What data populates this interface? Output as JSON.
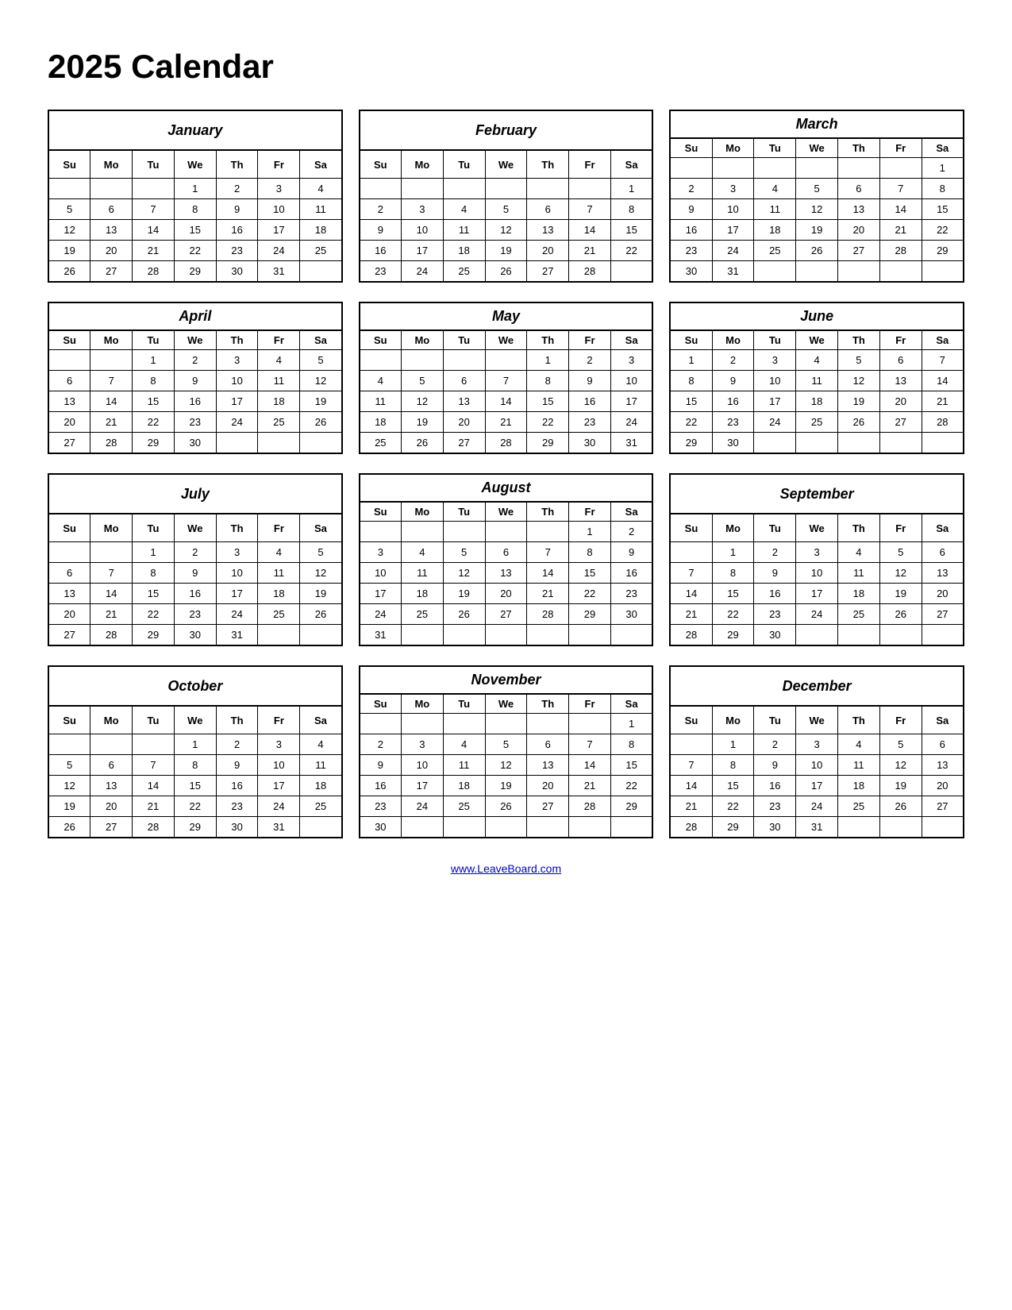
{
  "title": "2025 Calendar",
  "footer_link": "www.LeaveBoard.com",
  "months": [
    {
      "name": "January",
      "days_header": [
        "Su",
        "Mo",
        "Tu",
        "We",
        "Th",
        "Fr",
        "Sa"
      ],
      "weeks": [
        [
          "",
          "",
          "",
          "1",
          "2",
          "3",
          "4"
        ],
        [
          "5",
          "6",
          "7",
          "8",
          "9",
          "10",
          "11"
        ],
        [
          "12",
          "13",
          "14",
          "15",
          "16",
          "17",
          "18"
        ],
        [
          "19",
          "20",
          "21",
          "22",
          "23",
          "24",
          "25"
        ],
        [
          "26",
          "27",
          "28",
          "29",
          "30",
          "31",
          ""
        ]
      ]
    },
    {
      "name": "February",
      "days_header": [
        "Su",
        "Mo",
        "Tu",
        "We",
        "Th",
        "Fr",
        "Sa"
      ],
      "weeks": [
        [
          "",
          "",
          "",
          "",
          "",
          "",
          "1"
        ],
        [
          "2",
          "3",
          "4",
          "5",
          "6",
          "7",
          "8"
        ],
        [
          "9",
          "10",
          "11",
          "12",
          "13",
          "14",
          "15"
        ],
        [
          "16",
          "17",
          "18",
          "19",
          "20",
          "21",
          "22"
        ],
        [
          "23",
          "24",
          "25",
          "26",
          "27",
          "28",
          ""
        ]
      ]
    },
    {
      "name": "March",
      "days_header": [
        "Su",
        "Mo",
        "Tu",
        "We",
        "Th",
        "Fr",
        "Sa"
      ],
      "weeks": [
        [
          "",
          "",
          "",
          "",
          "",
          "",
          "1"
        ],
        [
          "2",
          "3",
          "4",
          "5",
          "6",
          "7",
          "8"
        ],
        [
          "9",
          "10",
          "11",
          "12",
          "13",
          "14",
          "15"
        ],
        [
          "16",
          "17",
          "18",
          "19",
          "20",
          "21",
          "22"
        ],
        [
          "23",
          "24",
          "25",
          "26",
          "27",
          "28",
          "29"
        ],
        [
          "30",
          "31",
          "",
          "",
          "",
          "",
          ""
        ]
      ]
    },
    {
      "name": "April",
      "days_header": [
        "Su",
        "Mo",
        "Tu",
        "We",
        "Th",
        "Fr",
        "Sa"
      ],
      "weeks": [
        [
          "",
          "",
          "1",
          "2",
          "3",
          "4",
          "5"
        ],
        [
          "6",
          "7",
          "8",
          "9",
          "10",
          "11",
          "12"
        ],
        [
          "13",
          "14",
          "15",
          "16",
          "17",
          "18",
          "19"
        ],
        [
          "20",
          "21",
          "22",
          "23",
          "24",
          "25",
          "26"
        ],
        [
          "27",
          "28",
          "29",
          "30",
          "",
          "",
          ""
        ]
      ]
    },
    {
      "name": "May",
      "days_header": [
        "Su",
        "Mo",
        "Tu",
        "We",
        "Th",
        "Fr",
        "Sa"
      ],
      "weeks": [
        [
          "",
          "",
          "",
          "",
          "1",
          "2",
          "3"
        ],
        [
          "4",
          "5",
          "6",
          "7",
          "8",
          "9",
          "10"
        ],
        [
          "11",
          "12",
          "13",
          "14",
          "15",
          "16",
          "17"
        ],
        [
          "18",
          "19",
          "20",
          "21",
          "22",
          "23",
          "24"
        ],
        [
          "25",
          "26",
          "27",
          "28",
          "29",
          "30",
          "31"
        ]
      ]
    },
    {
      "name": "June",
      "days_header": [
        "Su",
        "Mo",
        "Tu",
        "We",
        "Th",
        "Fr",
        "Sa"
      ],
      "weeks": [
        [
          "1",
          "2",
          "3",
          "4",
          "5",
          "6",
          "7"
        ],
        [
          "8",
          "9",
          "10",
          "11",
          "12",
          "13",
          "14"
        ],
        [
          "15",
          "16",
          "17",
          "18",
          "19",
          "20",
          "21"
        ],
        [
          "22",
          "23",
          "24",
          "25",
          "26",
          "27",
          "28"
        ],
        [
          "29",
          "30",
          "",
          "",
          "",
          "",
          ""
        ]
      ]
    },
    {
      "name": "July",
      "days_header": [
        "Su",
        "Mo",
        "Tu",
        "We",
        "Th",
        "Fr",
        "Sa"
      ],
      "weeks": [
        [
          "",
          "",
          "1",
          "2",
          "3",
          "4",
          "5"
        ],
        [
          "6",
          "7",
          "8",
          "9",
          "10",
          "11",
          "12"
        ],
        [
          "13",
          "14",
          "15",
          "16",
          "17",
          "18",
          "19"
        ],
        [
          "20",
          "21",
          "22",
          "23",
          "24",
          "25",
          "26"
        ],
        [
          "27",
          "28",
          "29",
          "30",
          "31",
          "",
          ""
        ]
      ]
    },
    {
      "name": "August",
      "days_header": [
        "Su",
        "Mo",
        "Tu",
        "We",
        "Th",
        "Fr",
        "Sa"
      ],
      "weeks": [
        [
          "",
          "",
          "",
          "",
          "",
          "1",
          "2"
        ],
        [
          "3",
          "4",
          "5",
          "6",
          "7",
          "8",
          "9"
        ],
        [
          "10",
          "11",
          "12",
          "13",
          "14",
          "15",
          "16"
        ],
        [
          "17",
          "18",
          "19",
          "20",
          "21",
          "22",
          "23"
        ],
        [
          "24",
          "25",
          "26",
          "27",
          "28",
          "29",
          "30"
        ],
        [
          "31",
          "",
          "",
          "",
          "",
          "",
          ""
        ]
      ]
    },
    {
      "name": "September",
      "days_header": [
        "Su",
        "Mo",
        "Tu",
        "We",
        "Th",
        "Fr",
        "Sa"
      ],
      "weeks": [
        [
          "",
          "1",
          "2",
          "3",
          "4",
          "5",
          "6"
        ],
        [
          "7",
          "8",
          "9",
          "10",
          "11",
          "12",
          "13"
        ],
        [
          "14",
          "15",
          "16",
          "17",
          "18",
          "19",
          "20"
        ],
        [
          "21",
          "22",
          "23",
          "24",
          "25",
          "26",
          "27"
        ],
        [
          "28",
          "29",
          "30",
          "",
          "",
          "",
          ""
        ]
      ]
    },
    {
      "name": "October",
      "days_header": [
        "Su",
        "Mo",
        "Tu",
        "We",
        "Th",
        "Fr",
        "Sa"
      ],
      "weeks": [
        [
          "",
          "",
          "",
          "1",
          "2",
          "3",
          "4"
        ],
        [
          "5",
          "6",
          "7",
          "8",
          "9",
          "10",
          "11"
        ],
        [
          "12",
          "13",
          "14",
          "15",
          "16",
          "17",
          "18"
        ],
        [
          "19",
          "20",
          "21",
          "22",
          "23",
          "24",
          "25"
        ],
        [
          "26",
          "27",
          "28",
          "29",
          "30",
          "31",
          ""
        ]
      ]
    },
    {
      "name": "November",
      "days_header": [
        "Su",
        "Mo",
        "Tu",
        "We",
        "Th",
        "Fr",
        "Sa"
      ],
      "weeks": [
        [
          "",
          "",
          "",
          "",
          "",
          "",
          "1"
        ],
        [
          "2",
          "3",
          "4",
          "5",
          "6",
          "7",
          "8"
        ],
        [
          "9",
          "10",
          "11",
          "12",
          "13",
          "14",
          "15"
        ],
        [
          "16",
          "17",
          "18",
          "19",
          "20",
          "21",
          "22"
        ],
        [
          "23",
          "24",
          "25",
          "26",
          "27",
          "28",
          "29"
        ],
        [
          "30",
          "",
          "",
          "",
          "",
          "",
          ""
        ]
      ]
    },
    {
      "name": "December",
      "days_header": [
        "Su",
        "Mo",
        "Tu",
        "We",
        "Th",
        "Fr",
        "Sa"
      ],
      "weeks": [
        [
          "",
          "1",
          "2",
          "3",
          "4",
          "5",
          "6"
        ],
        [
          "7",
          "8",
          "9",
          "10",
          "11",
          "12",
          "13"
        ],
        [
          "14",
          "15",
          "16",
          "17",
          "18",
          "19",
          "20"
        ],
        [
          "21",
          "22",
          "23",
          "24",
          "25",
          "26",
          "27"
        ],
        [
          "28",
          "29",
          "30",
          "31",
          "",
          "",
          ""
        ]
      ]
    }
  ]
}
